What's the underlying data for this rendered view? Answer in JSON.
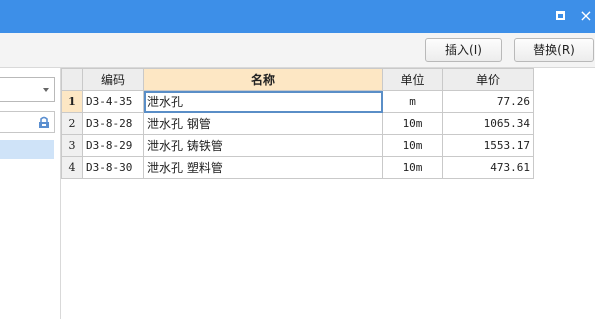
{
  "window": {
    "maximize_icon": "maximize-icon",
    "close_glyph": "×"
  },
  "toolbar": {
    "insert_label": "插入(I)",
    "replace_label": "替换(R)"
  },
  "grid": {
    "columns": [
      "编码",
      "名称",
      "单位",
      "单价"
    ],
    "rows": [
      {
        "num": "1",
        "code": "D3-4-35",
        "name": "泄水孔",
        "unit": "m",
        "price": "77.26"
      },
      {
        "num": "2",
        "code": "D3-8-28",
        "name": "泄水孔 钢管",
        "unit": "10m",
        "price": "1065.34"
      },
      {
        "num": "3",
        "code": "D3-8-29",
        "name": "泄水孔 铸铁管",
        "unit": "10m",
        "price": "1553.17"
      },
      {
        "num": "4",
        "code": "D3-8-30",
        "name": "泄水孔 塑料管",
        "unit": "10m",
        "price": "473.61"
      }
    ]
  },
  "colors": {
    "titlebar": "#3d8fe8",
    "header_highlight": "#fde7c4",
    "tree_selection": "#cfe3f8"
  }
}
